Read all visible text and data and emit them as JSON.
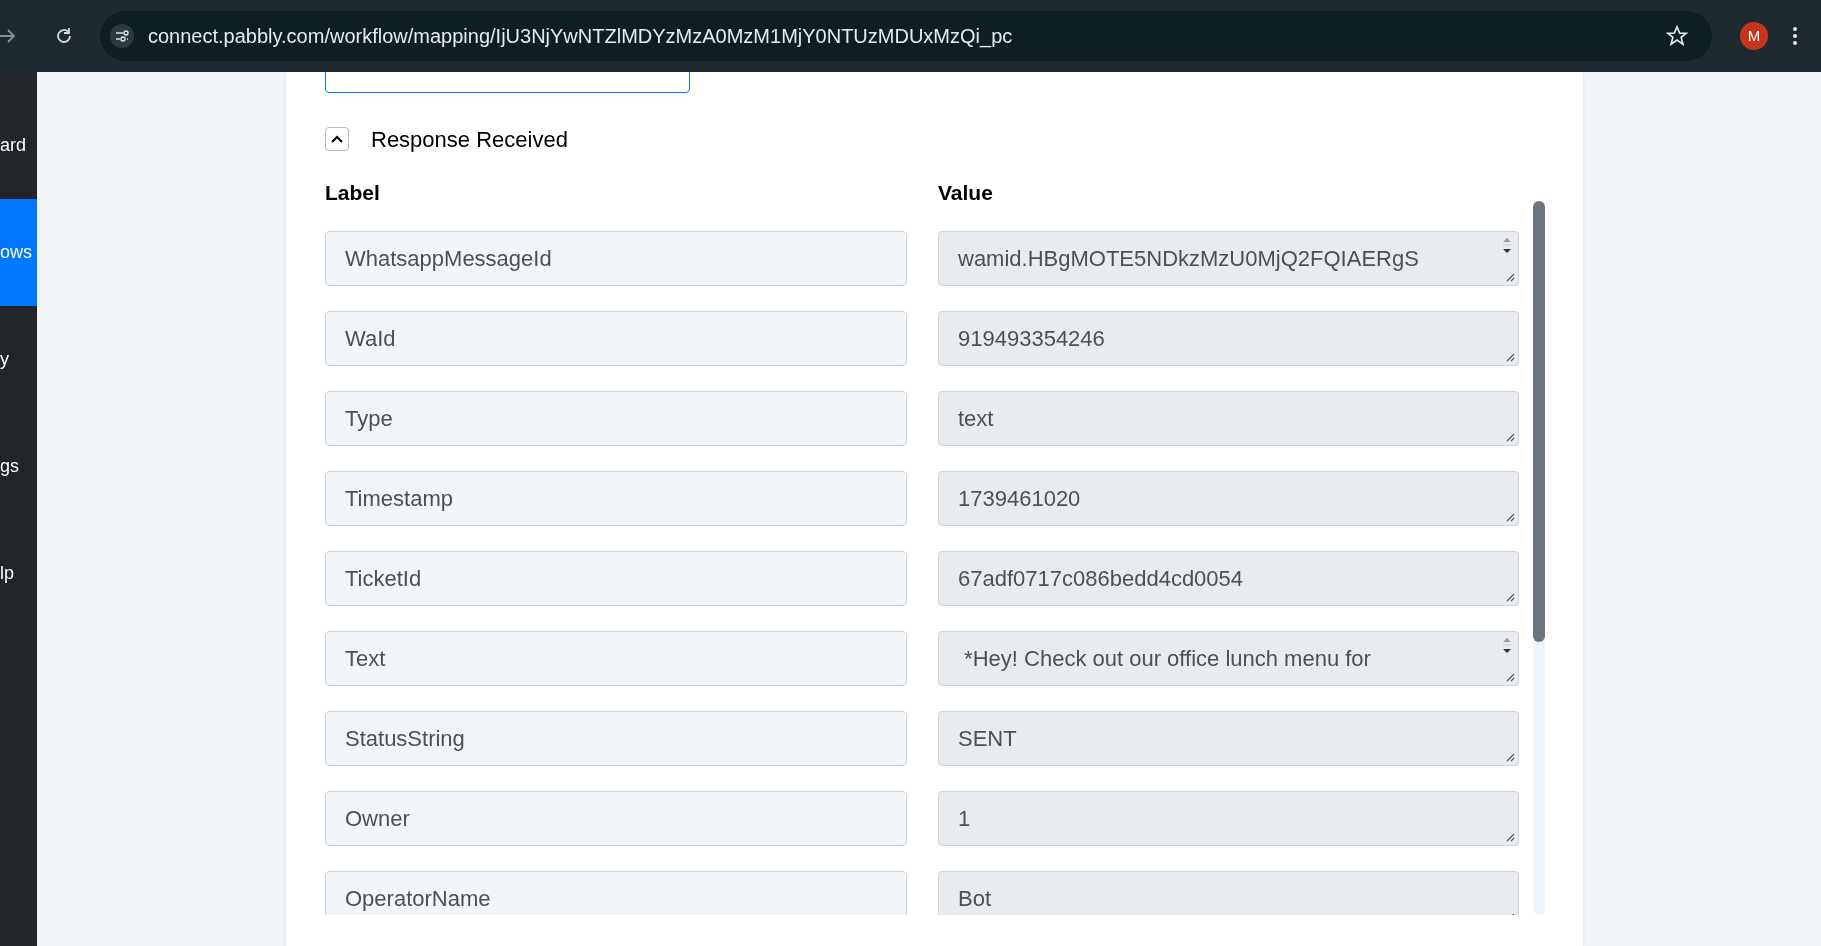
{
  "browser": {
    "url": "connect.pabbly.com/workflow/mapping/IjU3NjYwNTZlMDYzMzA0MzM1MjY0NTUzMDUxMzQi_pc",
    "avatar": "M"
  },
  "sidebar": {
    "items": [
      {
        "label": "ard",
        "selected": false
      },
      {
        "label": "ows",
        "selected": true
      },
      {
        "label": "y",
        "selected": false
      },
      {
        "label": "gs",
        "selected": false
      },
      {
        "label": "lp",
        "selected": false
      }
    ]
  },
  "section": {
    "title": "Response Received",
    "expanded": true
  },
  "columns": [
    "Label",
    "Value"
  ],
  "rows": [
    {
      "label": "WhatsappMessageId",
      "value": "wamid.HBgMOTE5NDkzMzU0MjQ2FQIAERgS",
      "scrollable": true
    },
    {
      "label": "WaId",
      "value": "919493354246",
      "scrollable": false
    },
    {
      "label": "Type",
      "value": "text",
      "scrollable": false
    },
    {
      "label": "Timestamp",
      "value": "1739461020",
      "scrollable": false
    },
    {
      "label": "TicketId",
      "value": "67adf0717c086bedd4cd0054",
      "scrollable": false
    },
    {
      "label": "Text",
      "value": " *Hey! Check out our office lunch menu for",
      "scrollable": true
    },
    {
      "label": "StatusString",
      "value": "SENT",
      "scrollable": false
    },
    {
      "label": "Owner",
      "value": "1",
      "scrollable": false
    },
    {
      "label": "OperatorName",
      "value": "Bot",
      "scrollable": false
    }
  ]
}
